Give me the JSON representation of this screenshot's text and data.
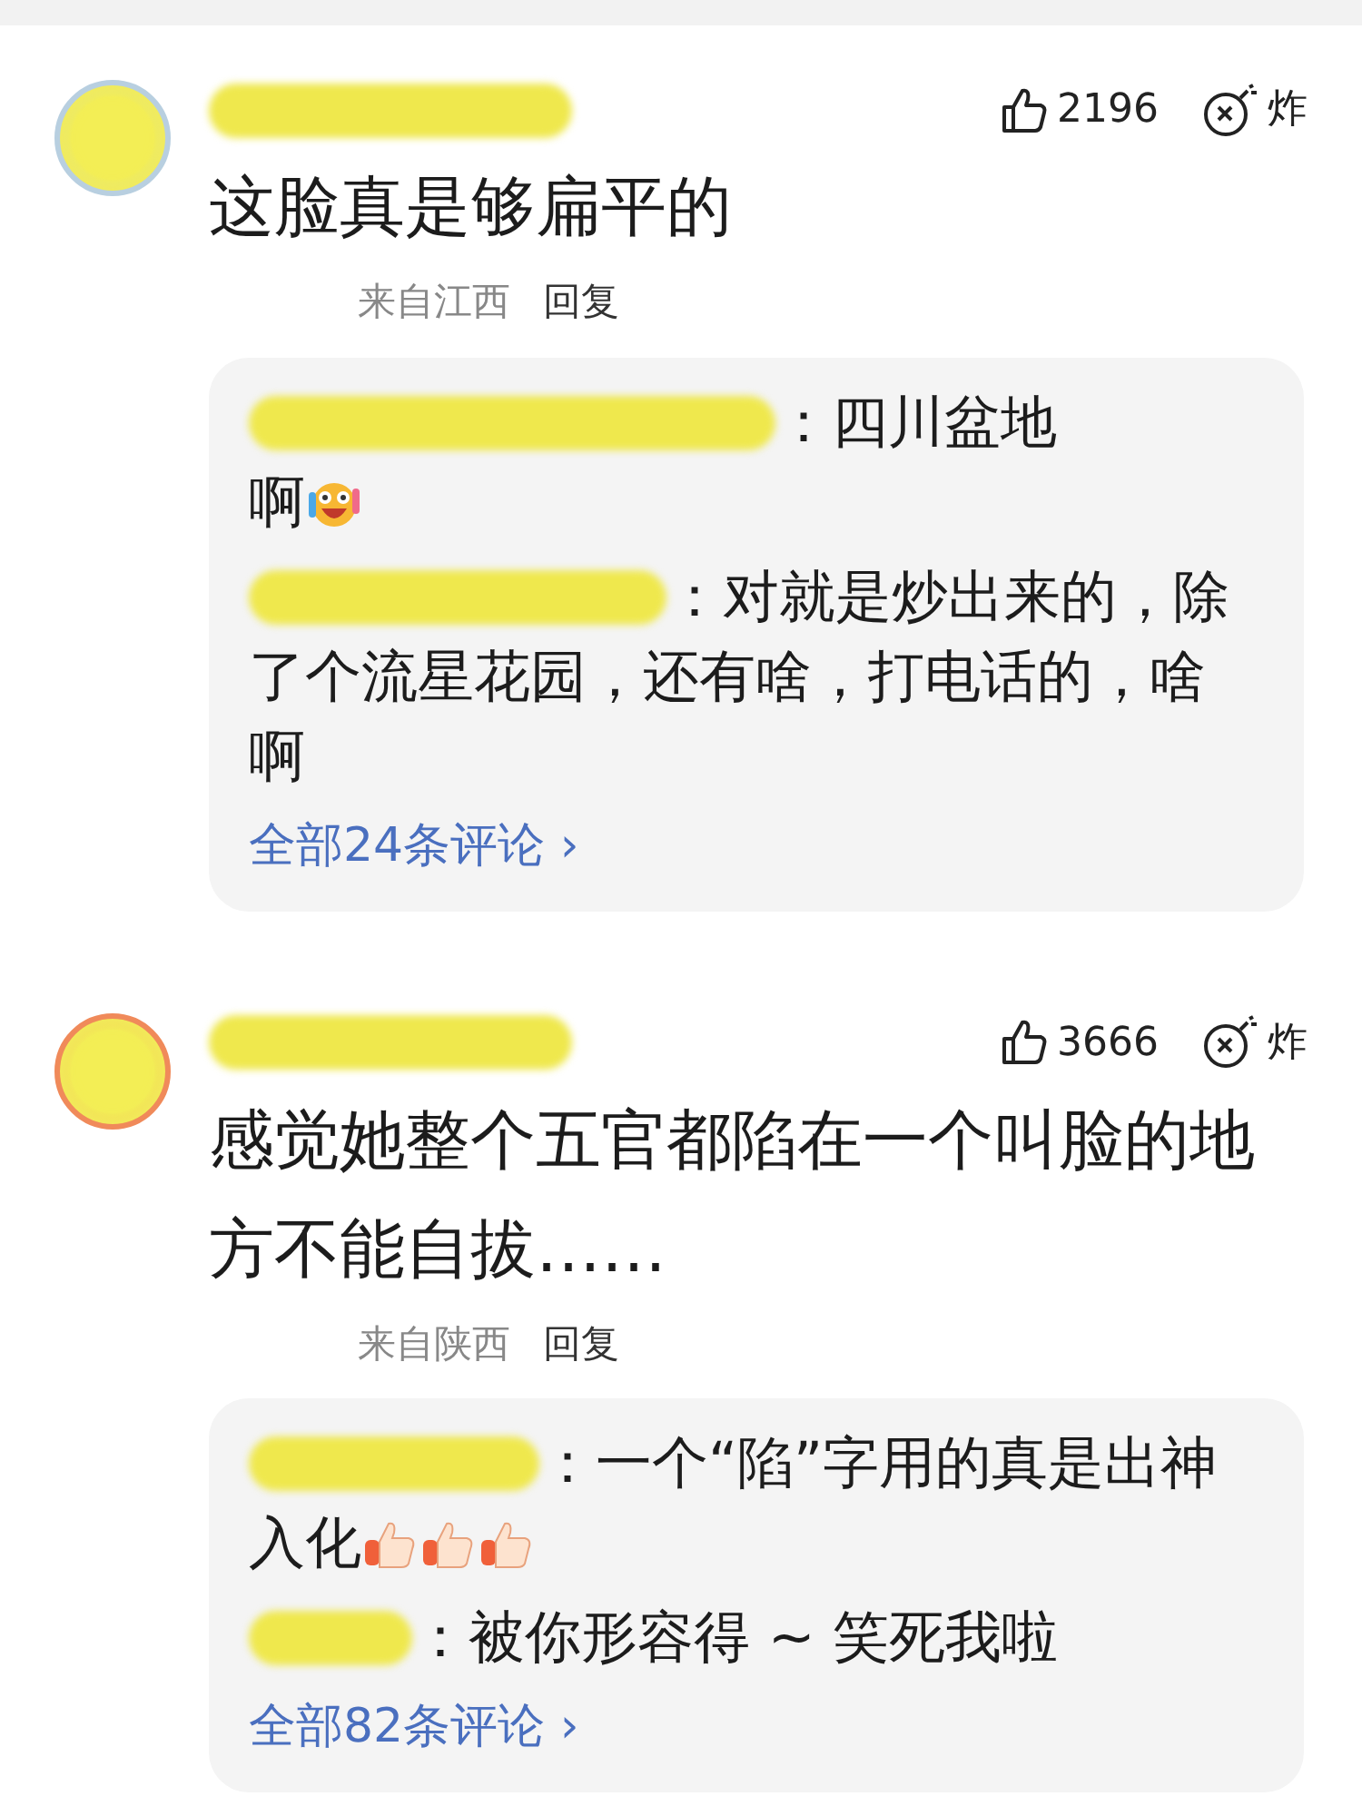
{
  "comments": [
    {
      "avatar": {
        "color": "#b8cfe0"
      },
      "likes": "2196",
      "bomb_label": "炸",
      "content": "这脸真是够扁平的",
      "location": "来自江西",
      "reply_label": "回复",
      "replies": [
        {
          "lines": [
            "：四川盆地",
            "啊"
          ],
          "emoji": [
            {
              "kind": "excited-face"
            }
          ]
        },
        {
          "lines": [
            "：对就是炒出来的，除",
            "了个流星花园，还有啥，打电话的，啥",
            "啊"
          ]
        }
      ],
      "more_link": "全部24条评论 ›"
    },
    {
      "avatar": {
        "color": "#f08a5a"
      },
      "likes": "3666",
      "bomb_label": "炸",
      "content": "感觉她整个五官都陷在一个叫脸的地方不能自拔……",
      "location": "来自陕西",
      "reply_label": "回复",
      "replies": [
        {
          "lines": [
            "：一个“陷”字用的真是出神",
            "入化"
          ],
          "emoji": [
            {
              "kind": "thumbs-up"
            },
            {
              "kind": "thumbs-up"
            },
            {
              "kind": "thumbs-up"
            }
          ]
        },
        {
          "lines": [
            "：被你形容得 ~ 笑死我啦"
          ]
        }
      ],
      "more_link": "全部82条评论 ›"
    }
  ]
}
